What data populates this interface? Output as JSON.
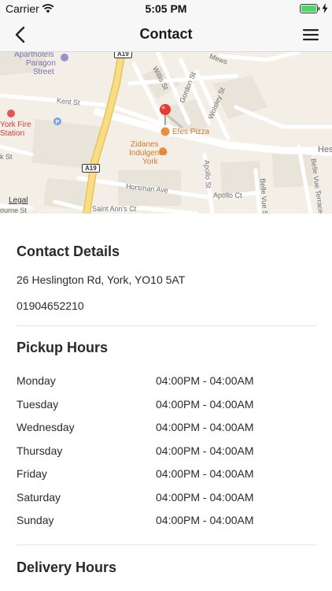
{
  "status_bar": {
    "carrier": "Carrier",
    "time": "5:05 PM"
  },
  "nav": {
    "title": "Contact",
    "back_icon": "chevron-left-icon",
    "menu_icon": "hamburger-menu-icon"
  },
  "map": {
    "labels": {
      "aparthotels": "Aparthotels",
      "paragon": "Paragon",
      "street": "Street",
      "kent_st": "Kent St",
      "york_fire": "York Fire",
      "station": "Station",
      "efes_pizza": "Efes Pizza",
      "zidanes": "Zidanes",
      "indulgence": "Indulgence",
      "york": "York",
      "a19_top": "A19",
      "a19_mid": "A19",
      "horsman_ave": "Horsman Ave",
      "apollo_ct": "Apollo Ct",
      "apollo_st": "Apollo St",
      "saint_anns_ct": "Saint Ann's Ct",
      "willis_st": "Willis St",
      "gordon_st": "Gordon St",
      "wolsley_st": "Wolsley St",
      "belle_vue_st": "Belle Vue St",
      "belle_vue_terrace": "Belle Vue Terrace",
      "mews": "Mews",
      "hes": "Hes",
      "k_st": "k St",
      "ourne_st": "ourne St",
      "legal": "Legal"
    },
    "colors": {
      "land": "#f3efe6",
      "block": "#e9e4da",
      "road": "#ffffff",
      "highway": "#f6d77a",
      "pin": "#e53935"
    }
  },
  "contact": {
    "heading": "Contact Details",
    "address": "26 Heslington Rd, York, YO10 5AT",
    "phone": "01904652210"
  },
  "pickup": {
    "heading": "Pickup Hours",
    "rows": [
      {
        "day": "Monday",
        "time": "04:00PM - 04:00AM"
      },
      {
        "day": "Tuesday",
        "time": "04:00PM - 04:00AM"
      },
      {
        "day": "Wednesday",
        "time": "04:00PM - 04:00AM"
      },
      {
        "day": "Thursday",
        "time": "04:00PM - 04:00AM"
      },
      {
        "day": "Friday",
        "time": "04:00PM - 04:00AM"
      },
      {
        "day": "Saturday",
        "time": "04:00PM - 04:00AM"
      },
      {
        "day": "Sunday",
        "time": "04:00PM - 04:00AM"
      }
    ]
  },
  "delivery": {
    "heading": "Delivery Hours"
  }
}
